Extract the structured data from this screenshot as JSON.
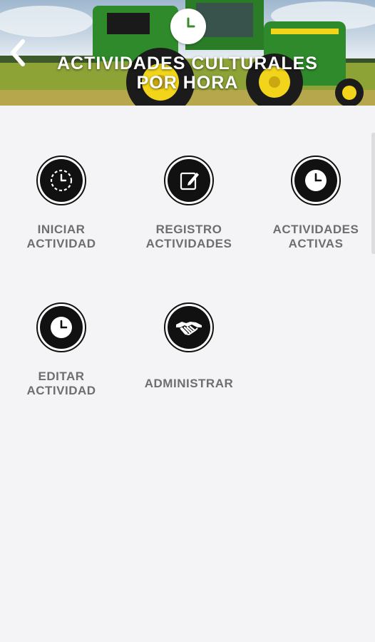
{
  "header": {
    "title": "ACTIVIDADES CULTURALES\nPOR HORA",
    "back_icon": "chevron-left-icon",
    "badge_icon": "clock-icon"
  },
  "tiles": [
    {
      "label": "INICIAR\nACTIVIDAD",
      "icon": "clock-start-icon"
    },
    {
      "label": "REGISTRO\nACTIVIDADES",
      "icon": "edit-document-icon"
    },
    {
      "label": "ACTIVIDADES\nACTIVAS",
      "icon": "clock-icon"
    },
    {
      "label": "EDITAR\nACTIVIDAD",
      "icon": "clock-icon"
    },
    {
      "label": "ADMINISTRAR",
      "icon": "handshake-icon"
    }
  ],
  "colors": {
    "accent_green": "#3a8a2a",
    "tractor_green": "#2f8a2b",
    "tractor_yellow": "#f2d51a",
    "label_gray": "#6e6e72",
    "background": "#f4f4f6"
  }
}
